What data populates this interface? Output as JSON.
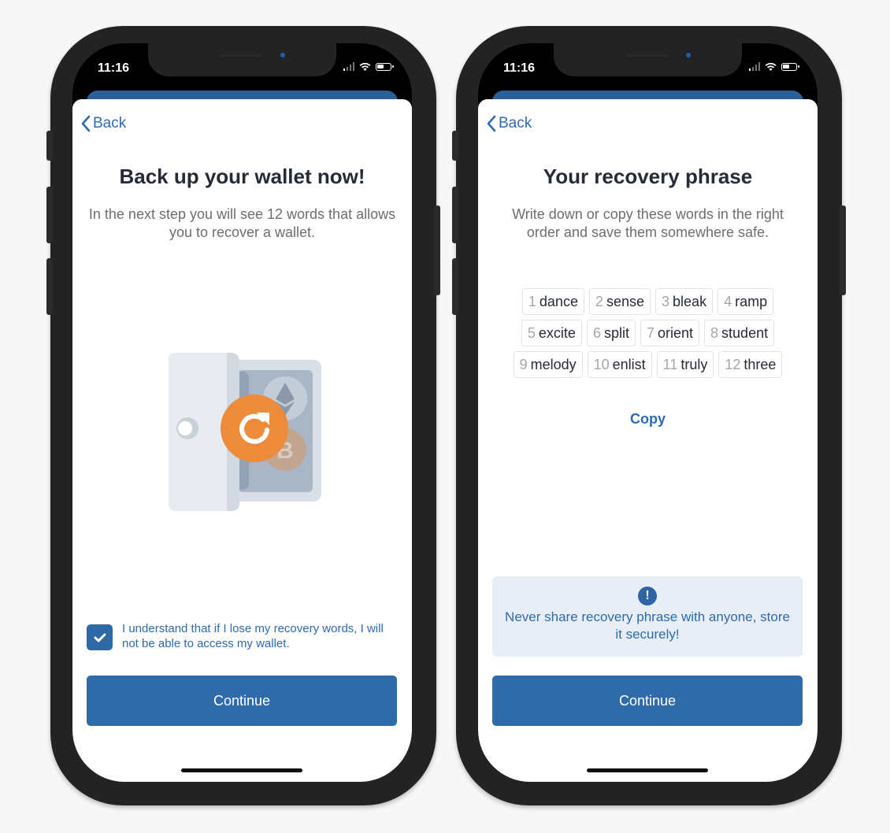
{
  "status_bar": {
    "time": "11:16"
  },
  "screens": [
    {
      "back_label": "Back",
      "title": "Back up your wallet now!",
      "subtitle": "In the next step you will see 12 words that allows you to recover a wallet.",
      "illustration": "safe-with-crypto-coins",
      "agreement": {
        "checked": true,
        "text": "I understand that if I lose my recovery words, I will not be able to access my wallet."
      },
      "continue_label": "Continue"
    },
    {
      "back_label": "Back",
      "title": "Your recovery phrase",
      "subtitle": "Write down or copy these words in the right order and save them somewhere safe.",
      "words": [
        {
          "n": "1",
          "w": "dance"
        },
        {
          "n": "2",
          "w": "sense"
        },
        {
          "n": "3",
          "w": "bleak"
        },
        {
          "n": "4",
          "w": "ramp"
        },
        {
          "n": "5",
          "w": "excite"
        },
        {
          "n": "6",
          "w": "split"
        },
        {
          "n": "7",
          "w": "orient"
        },
        {
          "n": "8",
          "w": "student"
        },
        {
          "n": "9",
          "w": "melody"
        },
        {
          "n": "10",
          "w": "enlist"
        },
        {
          "n": "11",
          "w": "truly"
        },
        {
          "n": "12",
          "w": "three"
        }
      ],
      "copy_label": "Copy",
      "warning": {
        "icon": "!",
        "text": "Never share recovery phrase with anyone, store it securely!"
      },
      "continue_label": "Continue"
    }
  ],
  "colors": {
    "accent": "#2f6aa9",
    "title": "#262b36",
    "subtitle": "#6d6e70",
    "warning_bg": "#e8eef5",
    "orange": "#ec8b3a"
  }
}
